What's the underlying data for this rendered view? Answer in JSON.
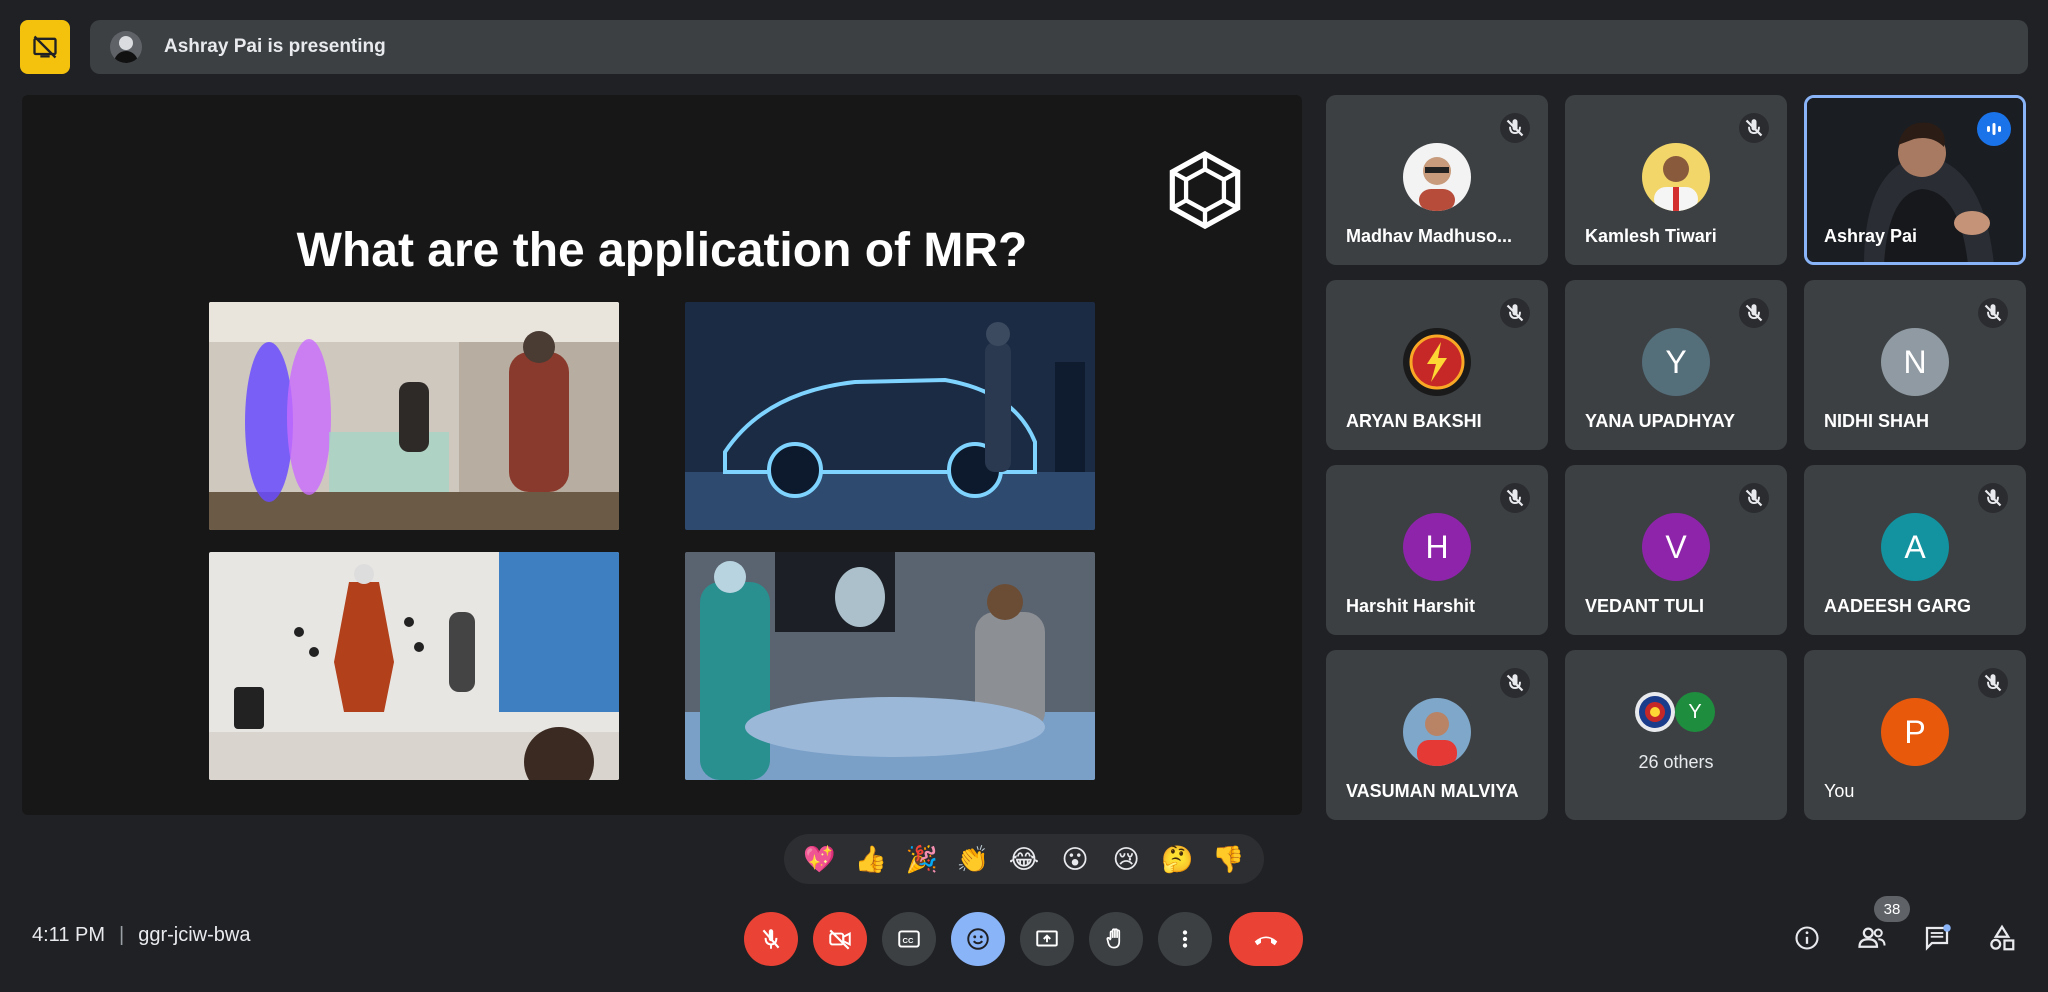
{
  "header": {
    "presenting_text": "Ashray Pai is presenting"
  },
  "slide": {
    "title": "What are the application of MR?"
  },
  "participants": [
    {
      "name": "Madhav Madhuso...",
      "avatar_type": "photo",
      "muted": true
    },
    {
      "name": "Kamlesh Tiwari",
      "avatar_type": "photo",
      "muted": true
    },
    {
      "name": "Ashray Pai",
      "avatar_type": "video",
      "speaking": true
    },
    {
      "name": "ARYAN BAKSHI",
      "avatar_type": "logo",
      "muted": true
    },
    {
      "name": "YANA UPADHYAY",
      "initial": "Y",
      "color": "#546e7a",
      "muted": true
    },
    {
      "name": "NIDHI SHAH",
      "initial": "N",
      "color": "#8f9aa2",
      "muted": true
    },
    {
      "name": "Harshit Harshit",
      "initial": "H",
      "color": "#8e24aa",
      "muted": true
    },
    {
      "name": "VEDANT TULI",
      "initial": "V",
      "color": "#8e24aa",
      "muted": true
    },
    {
      "name": "AADEESH GARG",
      "initial": "A",
      "color": "#12939f",
      "muted": true
    },
    {
      "name": "VASUMAN MALVIYA",
      "avatar_type": "photo",
      "muted": true
    },
    {
      "name": "26 others",
      "initial": "Y",
      "color": "#1e8e3e"
    },
    {
      "name": "You",
      "initial": "P",
      "color": "#e8590c",
      "muted": true
    }
  ],
  "reactions": [
    "💖",
    "👍",
    "🎉",
    "👏",
    "😂",
    "😮",
    "😢",
    "🤔",
    "👎"
  ],
  "meeting": {
    "time": "4:11 PM",
    "code": "ggr-jciw-bwa",
    "participant_count": "38"
  },
  "colors": {
    "accent_yellow": "#f4c20d",
    "danger_red": "#ea4335",
    "active_blue": "#8ab4f8",
    "tile_bg": "#3c4043"
  }
}
